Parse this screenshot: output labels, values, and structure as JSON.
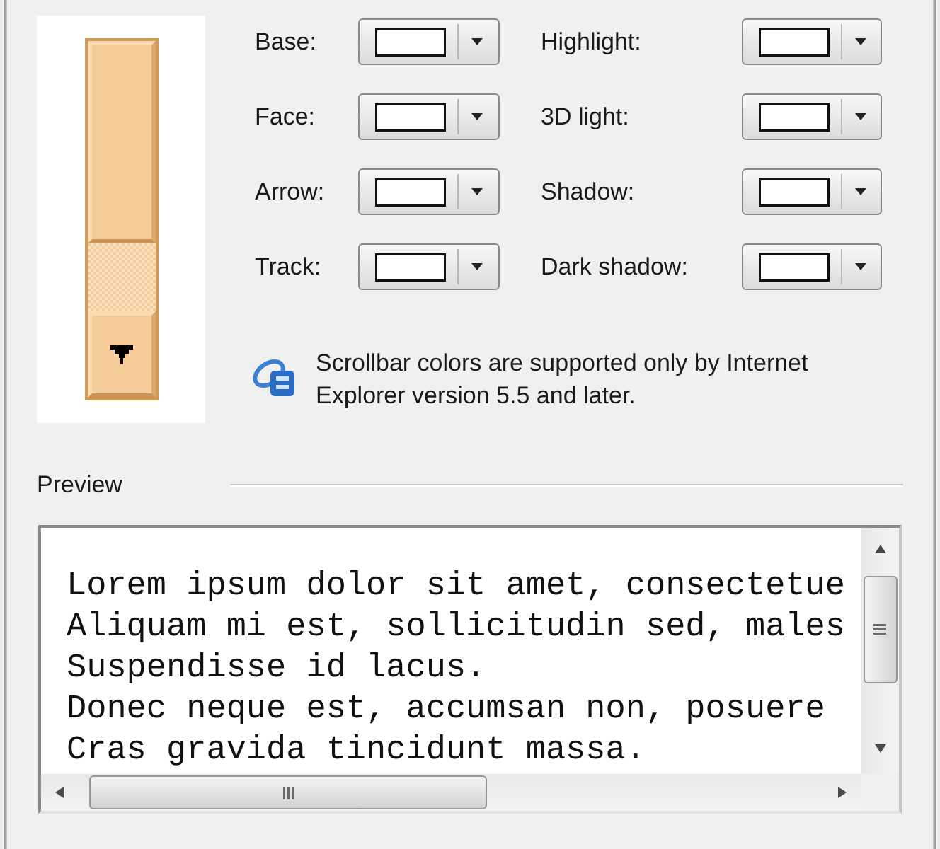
{
  "color_settings": [
    {
      "label": "Base:"
    },
    {
      "label": "Highlight:"
    },
    {
      "label": "Face:"
    },
    {
      "label": "3D light:"
    },
    {
      "label": "Arrow:"
    },
    {
      "label": "Shadow:"
    },
    {
      "label": "Track:"
    },
    {
      "label": "Dark shadow:"
    }
  ],
  "note": {
    "text": "Scrollbar colors are supported only by Internet Explorer version 5.5 and later."
  },
  "preview": {
    "title": "Preview",
    "lines": [
      "Lorem ipsum dolor sit amet, consectetue",
      "Aliquam mi est, sollicitudin sed, males",
      "Suspendisse id lacus.",
      "Donec neque est, accumsan non, posuere",
      "Cras gravida tincidunt massa."
    ]
  }
}
